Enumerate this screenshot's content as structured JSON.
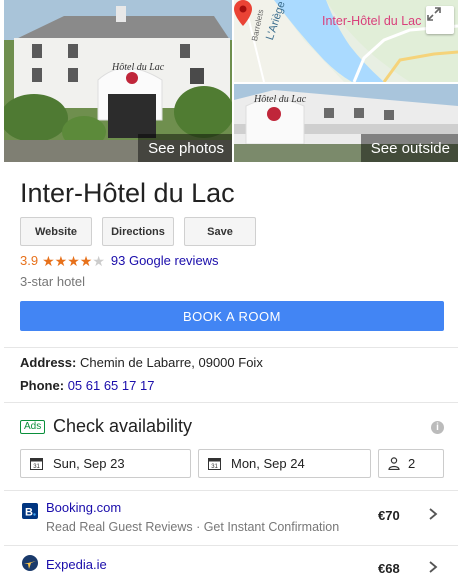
{
  "photos": {
    "see_photos_label": "See photos",
    "see_outside_label": "See outside",
    "hotel_sign_text": "Hôtel du Lac",
    "map": {
      "hotel_label": "Inter-Hôtel du Lac",
      "river_label": "L'Ariège",
      "street_label": "Barrelets"
    }
  },
  "hotel": {
    "name": "Inter-Hôtel du Lac",
    "rating": "3.9",
    "stars_filled": 4,
    "reviews_label": "93 Google reviews",
    "type": "3-star hotel"
  },
  "actions": {
    "website_label": "Website",
    "directions_label": "Directions",
    "save_label": "Save",
    "book_label": "BOOK A ROOM"
  },
  "details": {
    "address_label": "Address:",
    "address_value": "Chemin de Labarre, 09000 Foix",
    "phone_label": "Phone:",
    "phone_value": "05 61 65 17 17"
  },
  "availability": {
    "ads_badge": "Ads",
    "title": "Check availability",
    "check_in": "Sun, Sep 23",
    "check_out": "Mon, Sep 24",
    "guests": "2"
  },
  "offers": [
    {
      "name": "Booking.com",
      "description": "Read Real Guest Reviews · Get Instant Confirmation",
      "price": "€70"
    },
    {
      "name": "Expedia.ie",
      "description": "",
      "price": "€68"
    }
  ],
  "colors": {
    "accent_blue": "#4285f4",
    "link_blue": "#1a0dab",
    "star_orange": "#e7711b",
    "ads_green": "#0a8f3b"
  }
}
